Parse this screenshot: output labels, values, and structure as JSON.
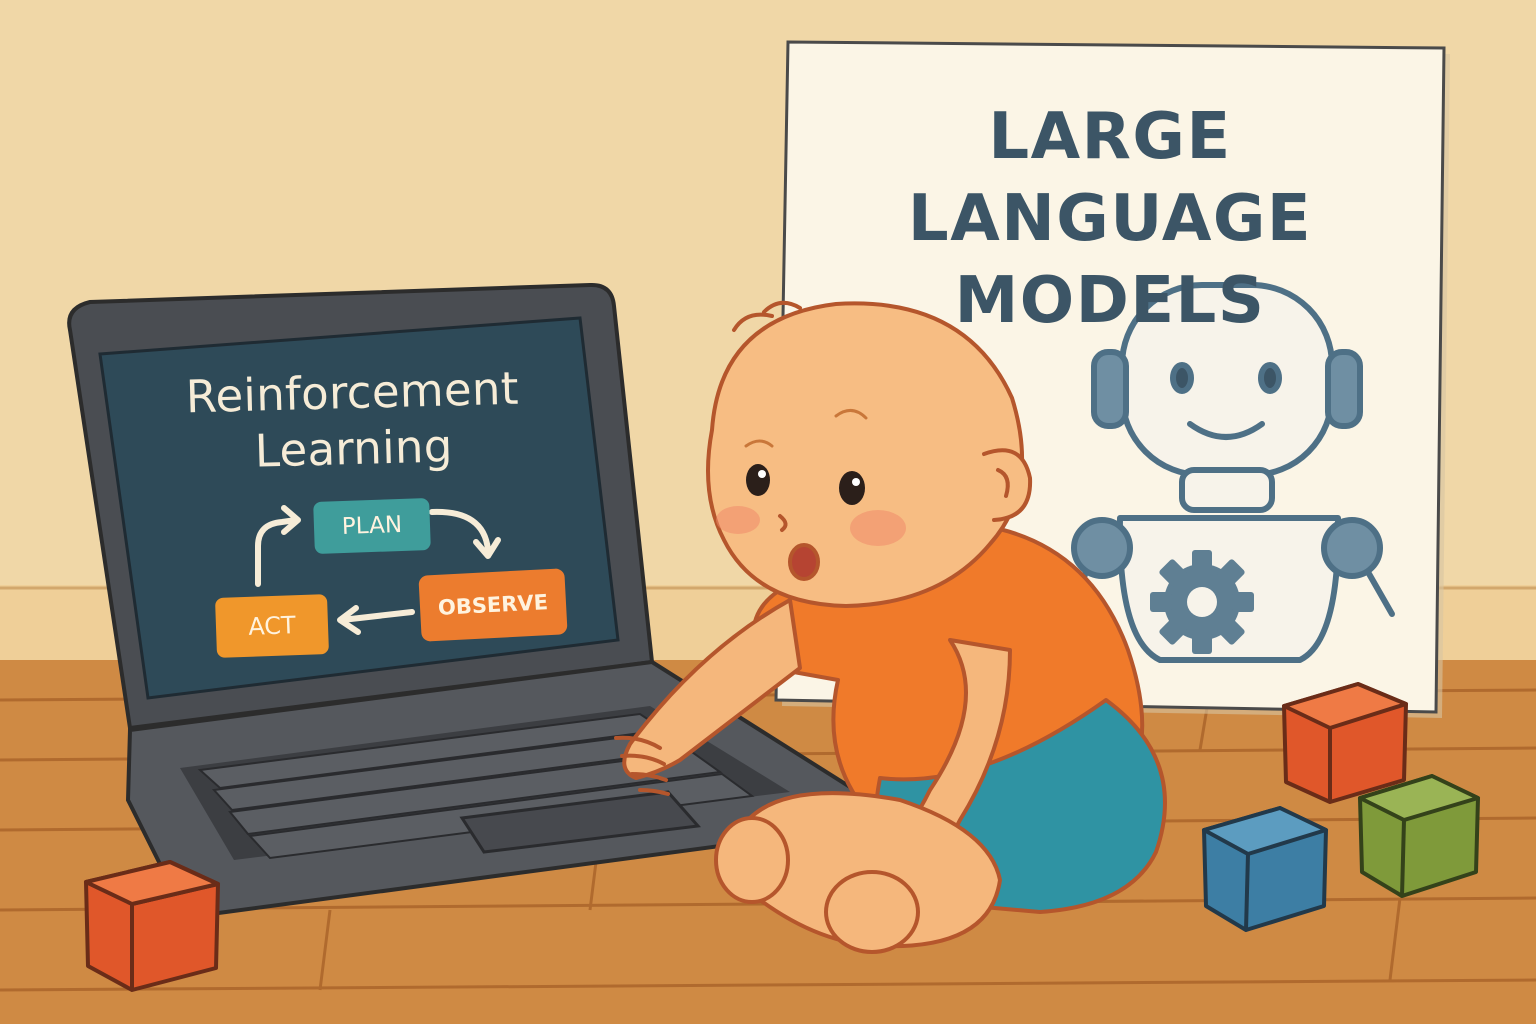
{
  "laptop_screen": {
    "title_line1": "Reinforcement",
    "title_line2": "Learning",
    "cycle": {
      "plan": "PLAN",
      "observe": "OBSERVE",
      "act": "ACT"
    }
  },
  "poster": {
    "title_line1": "LARGE LANGUAGE",
    "title_line2": "MODELS",
    "robot_icon": "robot-icon",
    "gear_icon": "gear-icon"
  },
  "colors": {
    "wall": "#f3dcae",
    "floor": "#cf8a44",
    "screen": "#2e4a58",
    "laptop_body": "#4a4d52",
    "plan_node": "#3f9d9b",
    "observe_node": "#ec7c2e",
    "act_node": "#f0972b",
    "poster_text": "#3c5566",
    "shirt": "#f07a2a",
    "diaper": "#2f93a3",
    "block_red": "#e0572a",
    "block_blue": "#3d7ea4",
    "block_green": "#7f9a3a"
  }
}
